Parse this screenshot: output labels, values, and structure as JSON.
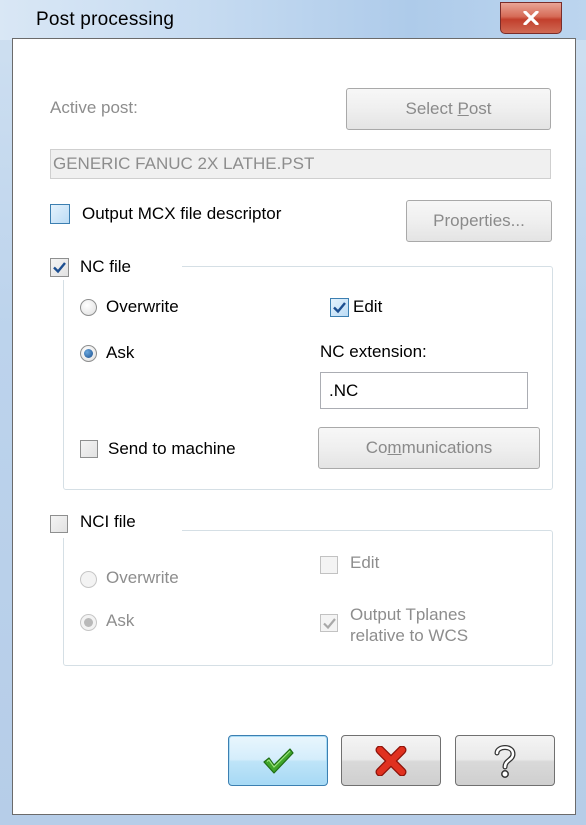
{
  "window": {
    "title": "Post processing",
    "close_icon": "close-x-icon"
  },
  "active_post": {
    "label": "Active post:",
    "select_button": "Select Post",
    "select_button_mnemonic": "P",
    "value": "GENERIC FANUC 2X LATHE.PST"
  },
  "descriptor": {
    "label": "Output MCX file descriptor",
    "checked": false,
    "properties_button": "Properties..."
  },
  "nc_file": {
    "group_label": "NC file",
    "checked": true,
    "overwrite_label": "Overwrite",
    "ask_label": "Ask",
    "selected": "Ask",
    "edit_label": "Edit",
    "edit_checked": true,
    "extension_label": "NC extension:",
    "extension_value": ".NC",
    "send_label": "Send to machine",
    "send_checked": false,
    "communications_button": "Communications",
    "communications_mnemonic": "m"
  },
  "nci_file": {
    "group_label": "NCI file",
    "checked": false,
    "overwrite_label": "Overwrite",
    "ask_label": "Ask",
    "selected": "Ask",
    "edit_label": "Edit",
    "edit_checked": false,
    "tplanes_label_line1": "Output Tplanes",
    "tplanes_label_line2": "relative to WCS",
    "tplanes_checked": true
  },
  "footer": {
    "ok_icon": "green-checkmark-icon",
    "cancel_icon": "red-x-icon",
    "help_icon": "question-mark-icon"
  },
  "colors": {
    "ok_green": "#3fa52a",
    "cancel_red": "#d9261c",
    "check_blue": "#1d4f91",
    "disabled_gray": "#8d8d8d"
  }
}
